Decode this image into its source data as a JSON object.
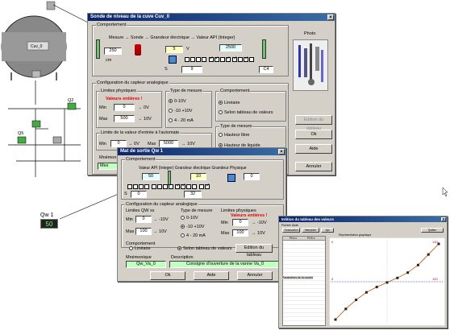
{
  "main_window": {
    "title": "Sonde de niveau de la cuve Cuv_0",
    "comportement_group": "Comportement",
    "mesure_chain": "Mesure → Sonde → Grandeur électrique → Valeur API (Integer)",
    "level_value": "250",
    "level_unit": "cm",
    "electric_value": "5",
    "electric_unit": "V",
    "api_value": "2500",
    "bit_s_label": "S",
    "bit_value": "9",
    "hex_value": "C4",
    "photo_label": "Photo",
    "config_group": "Configuration du capteur analogique",
    "limites_label": "Limites physiques",
    "valeurs_entieres": "Valeurs entières !",
    "min_label": "Min",
    "max_label": "Max",
    "min_value": "0",
    "max_value": "500",
    "min_arrow": "→ 0V",
    "max_arrow": "→ 10V",
    "type_mesure_label": "Type de mesure",
    "radio_0_10": "0-10V",
    "radio_pm10": "-10 +10V",
    "radio_4_20": "4 - 20 mA",
    "comportement2_label": "Comportement",
    "radio_lineaire": "Linéaire",
    "radio_tableau": "Selon tableau de valeurs",
    "edition_tableau": "Edition du tableau",
    "limite_api_label": "Limite de la valeur d'entrée à l'automate",
    "api_min": "0",
    "api_max": "5000",
    "api_min_arrow": "→ 0V",
    "api_max_arrow": "→ 10V",
    "type_mesure2_label": "Type de mesure",
    "hauteur_libre": "Hauteur libre",
    "hauteur_liquide": "Hauteur de liquide",
    "mnemonic_label": "Mnémon",
    "mnemonic_value": "Mes",
    "ok": "Ok",
    "aide": "Aide",
    "annuler": "Annuler"
  },
  "vanne_window": {
    "title": "Mat de sortie Qw 1",
    "comportement": "Comportement",
    "chain": "Valeur API (Integer)   Grandeur électrique   Grandeur Physique",
    "api_value": "50",
    "elec_value": "10",
    "phys_value": "0",
    "s_label": "S",
    "bit_a": "0",
    "bit_b": "32",
    "config": "Configuration du capteur analogique",
    "limites_qw": "Limites QW xx",
    "type_mesure": "Type de mesure",
    "limites_phys": "Limites physiques",
    "valeurs_entieres": "Valeurs entières !",
    "min": "Min",
    "max": "Max",
    "min_val": "0",
    "max_val": "100",
    "min_arrow": "→ -10V",
    "max_arrow": "→ 10V",
    "r1": "0-10V",
    "r2": "-10 +10V",
    "r3": "4 - 20 mA",
    "phys_min": "0",
    "phys_max": "100",
    "phys_min_arrow": "→ -10V",
    "phys_max_arrow": "→ 10V",
    "comportement2": "Comportement",
    "lineaire": "Linéaire",
    "tableau": "Selon tableau de valeurs",
    "edition": "Edition du tableau",
    "mnemonique": "Mnémonique",
    "description": "Description",
    "mnemo_value": "Qw_Va_0",
    "desc_value": "Consigne d'ouverture de la vanne Va_0",
    "ok": "Ok",
    "aide": "Aide",
    "annuler": "Annuler"
  },
  "tank": {
    "label": "Cuv_0"
  },
  "qw_badge": {
    "label": "Qw 1",
    "value": "50"
  },
  "scada_labels": {
    "q2": "Q2",
    "q5": "Q5"
  },
  "table_window": {
    "title": "Edition du tableau des valeurs",
    "menu_fichier": "Fichier",
    "menu_aide": "Aide",
    "btn_1": "Graduation",
    "btn_2": "Interpoler",
    "btn_3": "Ajo",
    "btn_quit": "Quitter",
    "col1": "PhV.x",
    "col2": "PHV.x",
    "graph_label": "Représentation graphique",
    "param_label": "Paramètres de la courbe",
    "chart_left_top": "0",
    "chart_right_top": "100",
    "chart_left_mid": "0",
    "chart_right_mid": "100"
  },
  "colors": {
    "titlebar": "#0a246a",
    "dialog_bg": "#d4d0c8",
    "value_red": "#e00000",
    "curve": "#c05000"
  },
  "chart_data": {
    "type": "line",
    "title": "Représentation graphique",
    "x": [
      0,
      10,
      20,
      30,
      40,
      50,
      60,
      70,
      80,
      90,
      100
    ],
    "series": [
      {
        "values": [
          0,
          14,
          26,
          36,
          43,
          49,
          55,
          62,
          72,
          86,
          100
        ]
      }
    ],
    "xlim": [
      0,
      100
    ],
    "ylim": [
      0,
      100
    ]
  }
}
